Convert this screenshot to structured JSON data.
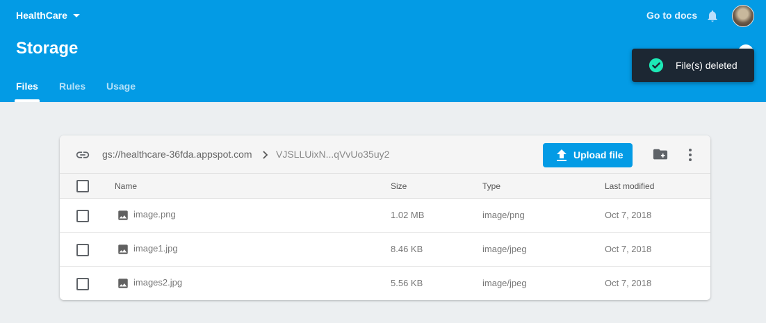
{
  "header": {
    "project": "HealthCare",
    "docs_link": "Go to docs",
    "title": "Storage",
    "tabs": [
      {
        "label": "Files",
        "active": true
      },
      {
        "label": "Rules",
        "active": false
      },
      {
        "label": "Usage",
        "active": false
      }
    ],
    "brand_color": "#039be5"
  },
  "toast": {
    "message": "File(s) deleted",
    "icon": "check-circle-icon",
    "icon_color": "#1de9b6"
  },
  "toolbar": {
    "bucket_path": "gs://healthcare-36fda.appspot.com",
    "folder_path": "VJSLLUixN...qVvUo35uy2",
    "upload_label": "Upload file",
    "new_folder_icon": "folder-plus-icon",
    "more_icon": "more-vert-icon",
    "link_icon": "link-icon"
  },
  "table": {
    "columns": [
      "Name",
      "Size",
      "Type",
      "Last modified"
    ],
    "rows": [
      {
        "name": "image.png",
        "size": "1.02 MB",
        "type": "image/png",
        "modified": "Oct 7, 2018"
      },
      {
        "name": "image1.jpg",
        "size": "8.46 KB",
        "type": "image/jpeg",
        "modified": "Oct 7, 2018"
      },
      {
        "name": "images2.jpg",
        "size": "5.56 KB",
        "type": "image/jpeg",
        "modified": "Oct 7, 2018"
      }
    ]
  }
}
